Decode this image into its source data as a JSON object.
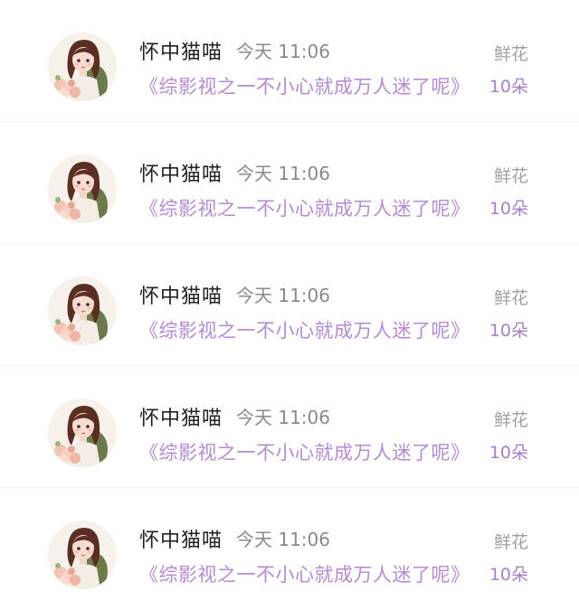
{
  "rows": [
    {
      "user_name": "怀中猫喵",
      "time": "今天 11:06",
      "gift_label": "鲜花",
      "book_title": "《综影视之一不小心就成万人迷了呢》",
      "gift_count": "10朵",
      "avatar_icon": "girl-avatar-icon"
    },
    {
      "user_name": "怀中猫喵",
      "time": "今天 11:06",
      "gift_label": "鲜花",
      "book_title": "《综影视之一不小心就成万人迷了呢》",
      "gift_count": "10朵",
      "avatar_icon": "girl-avatar-icon"
    },
    {
      "user_name": "怀中猫喵",
      "time": "今天 11:06",
      "gift_label": "鲜花",
      "book_title": "《综影视之一不小心就成万人迷了呢》",
      "gift_count": "10朵",
      "avatar_icon": "girl-avatar-icon"
    },
    {
      "user_name": "怀中猫喵",
      "time": "今天 11:06",
      "gift_label": "鲜花",
      "book_title": "《综影视之一不小心就成万人迷了呢》",
      "gift_count": "10朵",
      "avatar_icon": "girl-avatar-icon"
    },
    {
      "user_name": "怀中猫喵",
      "time": "今天 11:06",
      "gift_label": "鲜花",
      "book_title": "《综影视之一不小心就成万人迷了呢》",
      "gift_count": "10朵",
      "avatar_icon": "girl-avatar-icon"
    }
  ],
  "colors": {
    "name": "#222222",
    "time": "#8a8a8a",
    "gift_label": "#a0a0a0",
    "book_title": "#b48ad6",
    "gift_count": "#a77fcf"
  }
}
